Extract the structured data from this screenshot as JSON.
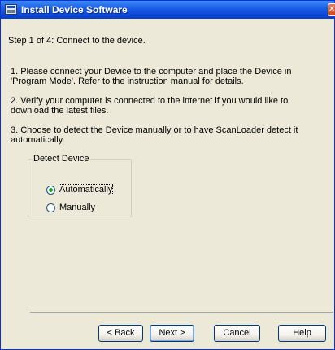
{
  "window": {
    "title": "Install Device Software"
  },
  "step": {
    "text": "Step 1 of 4:  Connect to the device."
  },
  "instructions": [
    "1.  Please connect your Device to the computer and place the Device in 'Program Mode'.  Refer to the instruction manual for details.",
    "2.  Verify your computer is connected to the internet if you would like to download the latest files.",
    "3.  Choose to detect the Device manually or to have ScanLoader detect it automatically."
  ],
  "detect_group": {
    "legend": "Detect Device",
    "options": [
      {
        "label": "Automatically",
        "selected": true
      },
      {
        "label": "Manually",
        "selected": false
      }
    ]
  },
  "buttons": {
    "back": {
      "label": "< Back",
      "enabled": false
    },
    "next": {
      "label": "Next >",
      "enabled": true
    },
    "cancel": {
      "label": "Cancel",
      "enabled": true
    },
    "help": {
      "label": "Help",
      "enabled": true
    }
  },
  "icons": {
    "app": "install-window-icon",
    "close": "close-icon"
  },
  "colors": {
    "titlebar": "#0a46d6",
    "dialog_bg": "#ece9d8",
    "radio_dot": "#21a121"
  }
}
